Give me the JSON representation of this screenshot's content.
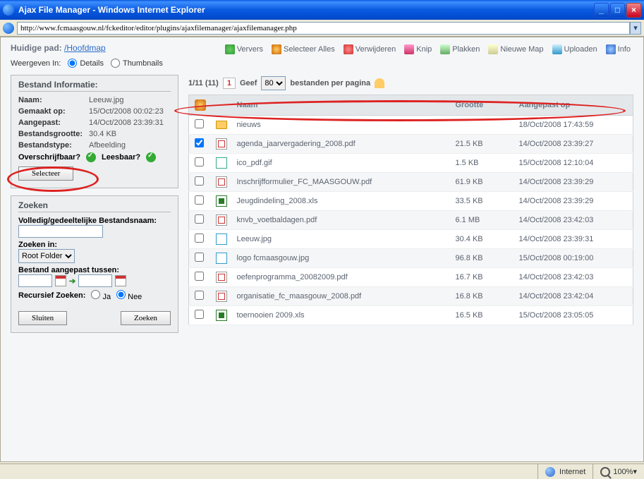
{
  "window": {
    "title": "Ajax File Manager - Windows Internet Explorer",
    "url": "http://www.fcmaasgouw.nl/fckeditor/editor/plugins/ajaxfilemanager/ajaxfilemanager.php"
  },
  "path": {
    "label": "Huidige pad:",
    "link": "/Hoofdmap"
  },
  "toolbar": {
    "refresh": "Ververs",
    "select_all": "Selecteer Alles",
    "delete": "Verwijderen",
    "cut": "Knip",
    "paste": "Plakken",
    "new_folder": "Nieuwe Map",
    "upload": "Uploaden",
    "info": "Info"
  },
  "view": {
    "label": "Weergeven In:",
    "details": "Details",
    "thumbnails": "Thumbnails",
    "selected": "details"
  },
  "info_panel": {
    "heading": "Bestand Informatie:",
    "labels": {
      "name": "Naam:",
      "created": "Gemaakt op:",
      "modified": "Aangepast:",
      "size": "Bestandsgrootte:",
      "type": "Bestandstype:",
      "writable": "Overschrijfbaar?",
      "readable": "Leesbaar?"
    },
    "values": {
      "name": "Leeuw.jpg",
      "created": "15/Oct/2008 00:02:23",
      "modified": "14/Oct/2008 23:39:31",
      "size": "30.4 KB",
      "type": "Afbeelding"
    },
    "select_button": "Selecteer"
  },
  "search": {
    "heading": "Zoeken",
    "filename_label": "Volledig/gedeeltelijke Bestandsnaam:",
    "filename_value": "",
    "searchin_label": "Zoeken in:",
    "searchin_value": "Root Folder",
    "modified_label": "Bestand aangepast tussen:",
    "date_from": "",
    "date_to": "",
    "recursive_label": "Recursief Zoeken:",
    "yes": "Ja",
    "no": "Nee",
    "recursive_selected": "no",
    "close": "Sluiten",
    "search": "Zoeken"
  },
  "pager": {
    "summary": "1/11 (11)",
    "page": "1",
    "give": "Geef",
    "per_page": "80",
    "suffix": "bestanden per pagina"
  },
  "columns": {
    "name": "Naam",
    "size": "Grootte",
    "modified": "Aangepast op"
  },
  "files": [
    {
      "checked": false,
      "icon": "folder",
      "name": "nieuws",
      "size": "",
      "modified": "18/Oct/2008 17:43:59"
    },
    {
      "checked": true,
      "icon": "pdf",
      "name": "agenda_jaarvergadering_2008.pdf",
      "size": "21.5 KB",
      "modified": "14/Oct/2008 23:39:27"
    },
    {
      "checked": false,
      "icon": "gif",
      "name": "ico_pdf.gif",
      "size": "1.5 KB",
      "modified": "15/Oct/2008 12:10:04"
    },
    {
      "checked": false,
      "icon": "pdf",
      "name": "Inschrijfformulier_FC_MAASGOUW.pdf",
      "size": "61.9 KB",
      "modified": "14/Oct/2008 23:39:29"
    },
    {
      "checked": false,
      "icon": "xls",
      "name": "Jeugdindeling_2008.xls",
      "size": "33.5 KB",
      "modified": "14/Oct/2008 23:39:29"
    },
    {
      "checked": false,
      "icon": "pdf",
      "name": "knvb_voetbaldagen.pdf",
      "size": "6.1 MB",
      "modified": "14/Oct/2008 23:42:03"
    },
    {
      "checked": false,
      "icon": "jpg",
      "name": "Leeuw.jpg",
      "size": "30.4 KB",
      "modified": "14/Oct/2008 23:39:31"
    },
    {
      "checked": false,
      "icon": "jpg",
      "name": "logo fcmaasgouw.jpg",
      "size": "96.8 KB",
      "modified": "15/Oct/2008 00:19:00"
    },
    {
      "checked": false,
      "icon": "pdf",
      "name": "oefenprogramma_20082009.pdf",
      "size": "16.7 KB",
      "modified": "14/Oct/2008 23:42:03"
    },
    {
      "checked": false,
      "icon": "pdf",
      "name": "organisatie_fc_maasgouw_2008.pdf",
      "size": "16.8 KB",
      "modified": "14/Oct/2008 23:42:04"
    },
    {
      "checked": false,
      "icon": "xls",
      "name": "toernooien 2009.xls",
      "size": "16.5 KB",
      "modified": "15/Oct/2008 23:05:05"
    }
  ],
  "statusbar": {
    "zone": "Internet",
    "zoom": "100%"
  }
}
